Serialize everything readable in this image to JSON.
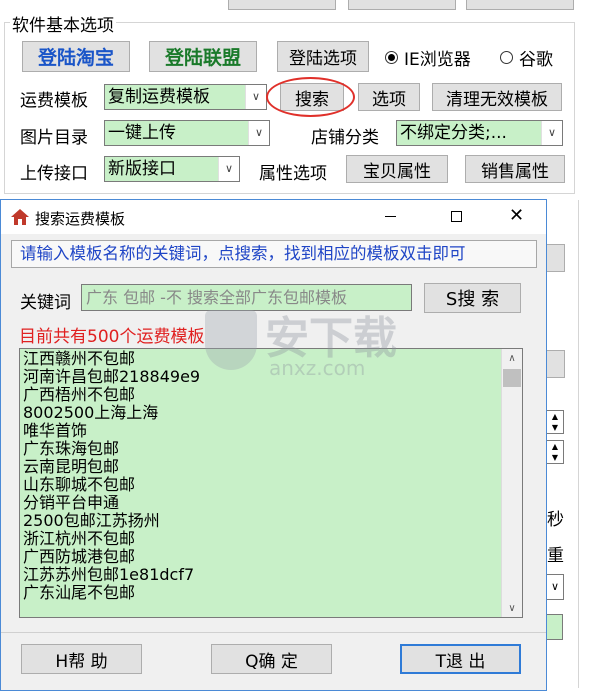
{
  "main": {
    "group_title": "软件基本选项",
    "btn_login_taobao": "登陆淘宝",
    "btn_login_alliance": "登陆联盟",
    "btn_login_options": "登陆选项",
    "radio_ie": "IE浏览器",
    "radio_google": "谷歌",
    "label_freight_template": "运费模板",
    "combo_freight_value": "复制运费模板",
    "btn_search": "搜索",
    "btn_options": "选项",
    "btn_clear_invalid": "清理无效模板",
    "label_image_dir": "图片目录",
    "combo_image_value": "一键上传",
    "label_shop_category": "店铺分类",
    "combo_category_value": "不绑定分类;...",
    "label_upload_api": "上传接口",
    "combo_api_value": "新版接口",
    "label_attr_options": "属性选项",
    "btn_item_attrs": "宝贝属性",
    "btn_sale_attrs": "销售属性",
    "right_char_1": "秒",
    "right_char_2": "重"
  },
  "dialog": {
    "title": "搜索运费模板",
    "hint": "请输入模板名称的关键词，点搜索，找到相应的模板双击即可",
    "keyword_label": "关键词",
    "keyword_placeholder": "广东 包邮 -不 搜索全部广东包邮模板",
    "search_button": "S搜 索",
    "count_text": "目前共有500个运费模板",
    "items": [
      "江西赣州不包邮",
      "河南许昌包邮218849e9",
      "广西梧州不包邮",
      "8002500上海上海",
      "唯华首饰",
      "广东珠海包邮",
      "云南昆明包邮",
      "山东聊城不包邮",
      "分销平台申通",
      "2500包邮江苏扬州",
      "浙江杭州不包邮",
      "广西防城港包邮",
      "江苏苏州包邮1e81dcf7",
      "广东汕尾不包邮"
    ],
    "help_button": "H帮  助",
    "ok_button": "Q确  定",
    "exit_button": "T退  出"
  },
  "watermark": {
    "text_cn": "安下载",
    "text_en": "anxz.com"
  },
  "colors": {
    "combo_bg": "#c8f0c8",
    "hint_text": "#1f45c6",
    "count_text": "#e02020",
    "highlight_circle": "#e0302a",
    "dialog_border": "#4b8ad6",
    "title_icon": "#c0392b"
  }
}
